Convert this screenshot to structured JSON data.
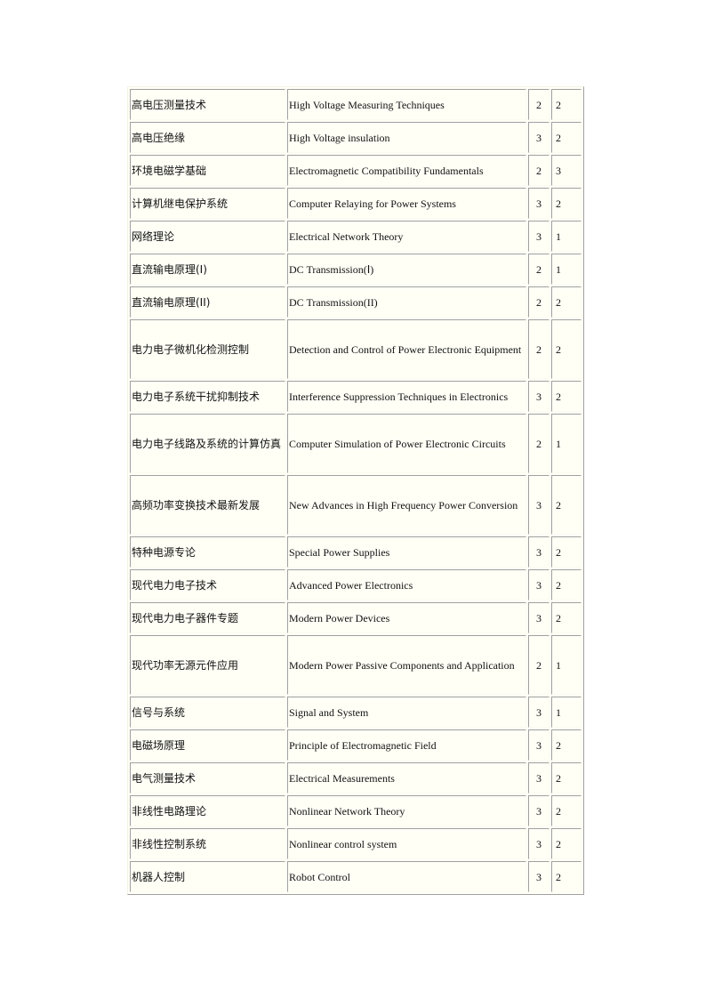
{
  "table": {
    "rows": [
      {
        "cn": "高电压测量技术",
        "en": "High Voltage Measuring Techniques",
        "a": "2",
        "b": "2",
        "tall": false
      },
      {
        "cn": "高电压绝缘",
        "en": "High Voltage insulation",
        "a": "3",
        "b": "2",
        "tall": false
      },
      {
        "cn": "环境电磁学基础",
        "en": "Electromagnetic  Compatibility Fundamentals",
        "a": "2",
        "b": "3",
        "tall": false
      },
      {
        "cn": "计算机继电保护系统",
        "en": "Computer Relaying for Power Systems",
        "a": "3",
        "b": "2",
        "tall": false
      },
      {
        "cn": "网络理论",
        "en": "Electrical  Network Theory",
        "a": "3",
        "b": "1",
        "tall": false
      },
      {
        "cn": "直流输电原理(Ⅰ)",
        "en": "DC Transmission(Ⅰ)",
        "a": "2",
        "b": "1",
        "tall": false
      },
      {
        "cn": "直流输电原理(II)",
        "en": "DC Transmission(II)",
        "a": "2",
        "b": "2",
        "tall": false
      },
      {
        "cn": "电力电子微机化检测控制",
        "en": "Detection and Control of Power Electronic Equipment",
        "a": "2",
        "b": "2",
        "tall": true
      },
      {
        "cn": "电力电子系统干扰抑制技术",
        "en": "Interference Suppression Techniques in Electronics",
        "a": "3",
        "b": "2",
        "tall": false
      },
      {
        "cn": "电力电子线路及系统的计算仿真",
        "en": "Computer Simulation of Power Electronic Circuits",
        "a": "2",
        "b": "1",
        "tall": true
      },
      {
        "cn": "高频功率变换技术最新发展",
        "en": "New Advances in High Frequency Power Conversion",
        "a": "3",
        "b": "2",
        "tall": true
      },
      {
        "cn": "特种电源专论",
        "en": "Special Power Supplies",
        "a": "3",
        "b": "2",
        "tall": false
      },
      {
        "cn": "现代电力电子技术",
        "en": "Advanced Power Electronics",
        "a": "3",
        "b": "2",
        "tall": false
      },
      {
        "cn": "现代电力电子器件专题",
        "en": "Modern Power Devices",
        "a": "3",
        "b": "2",
        "tall": false
      },
      {
        "cn": "现代功率无源元件应用",
        "en": "Modern Power Passive Components and Application",
        "a": "2",
        "b": "1",
        "tall": true
      },
      {
        "cn": "信号与系统",
        "en": "Signal and System",
        "a": "3",
        "b": "1",
        "tall": false
      },
      {
        "cn": "电磁场原理",
        "en": "Principle of Electromagnetic  Field",
        "a": "3",
        "b": "2",
        "tall": false
      },
      {
        "cn": "电气测量技术",
        "en": "Electrical  Measurements",
        "a": "3",
        "b": "2",
        "tall": false
      },
      {
        "cn": "非线性电路理论",
        "en": "Nonlinear Network Theory",
        "a": "3",
        "b": "2",
        "tall": false
      },
      {
        "cn": "非线性控制系统",
        "en": "Nonlinear control system",
        "a": "3",
        "b": "2",
        "tall": false
      },
      {
        "cn": "机器人控制",
        "en": "Robot Control",
        "a": "3",
        "b": "2",
        "tall": false
      }
    ]
  }
}
